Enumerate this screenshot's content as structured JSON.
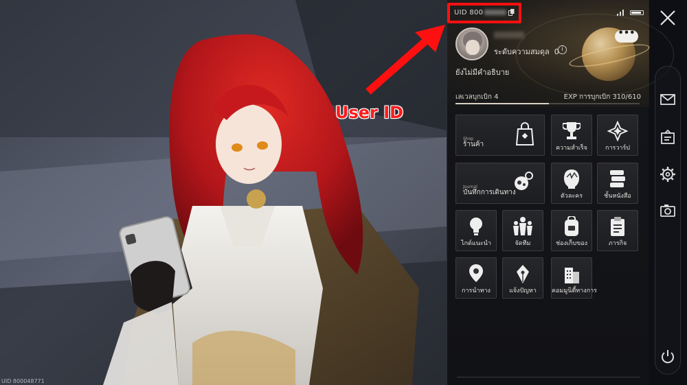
{
  "annotation": {
    "label": "User ID"
  },
  "header": {
    "uid_prefix": "UID 800"
  },
  "profile": {
    "balance_label": "ระดับความสมดุล",
    "balance_value": "0",
    "signature": "ยังไม่มีคำอธิบาย",
    "more_label": "•••"
  },
  "progress": {
    "level_label": "เลเวลบุกเบิก 4",
    "exp_label": "EXP การบุกเบิก 310/610",
    "exp_current": 310,
    "exp_max": 610
  },
  "menu": {
    "shop": {
      "label": "ร้านค้า",
      "sub": "Shop"
    },
    "achievements": {
      "label": "ความสำเร็จ"
    },
    "warp": {
      "label": "การวาร์ป"
    },
    "journal": {
      "label": "บันทึกการเดินทาง",
      "sub": "Journal"
    },
    "characters": {
      "label": "ตัวละคร"
    },
    "archive": {
      "label": "ชั้นหนังสือ"
    },
    "guide": {
      "label": "ไกด์แนะนำ"
    },
    "team": {
      "label": "จัดทีม"
    },
    "inventory": {
      "label": "ช่องเก็บของ"
    },
    "missions": {
      "label": "ภารกิจ"
    },
    "navigation": {
      "label": "การนำทาง"
    },
    "feedback": {
      "label": "แจ้งปัญหา"
    },
    "community": {
      "label": "คอมมูนิตี้ทางการ"
    }
  },
  "background": {
    "uid_watermark": "UID 800048771"
  },
  "colors": {
    "annotation_red": "#ff1a1a",
    "panel_bg": "#141518",
    "accent_gold": "#c49c59"
  }
}
